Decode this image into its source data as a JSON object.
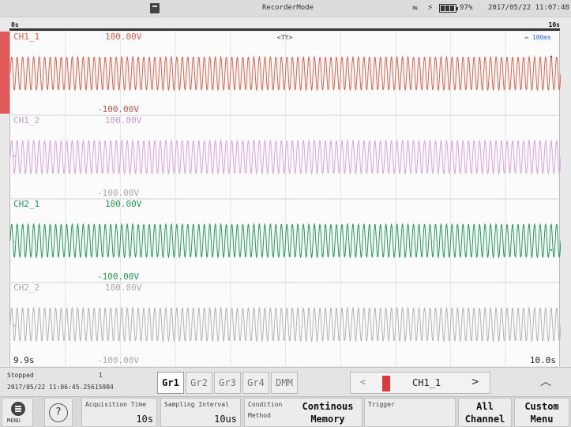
{
  "status_bar": {
    "mode": "RecorderMode",
    "battery_percent": "97%",
    "datetime": "2017/05/22 11:07:48",
    "icons": [
      "recorder-mode-icon",
      "usb-icon",
      "power-bolt-icon",
      "battery-icon"
    ]
  },
  "time_ruler": {
    "start": "0s",
    "end": "10s"
  },
  "waveform": {
    "trigger_label": "<TY>",
    "time_div": "↔ 100ms",
    "cursor_left": "9.9s",
    "cursor_right": "10.0s",
    "channels": [
      {
        "name": "CH1_1",
        "top": "100.00V",
        "bottom": "-100.00V",
        "color": "#e0604a"
      },
      {
        "name": "CH1_2",
        "top": "100.00V",
        "bottom": "-100.00V",
        "color": "#d7a5d9"
      },
      {
        "name": "CH2_1",
        "top": "100.00V",
        "bottom": "-100.00V",
        "color": "#1f9a55"
      },
      {
        "name": "CH2_2",
        "top": "100.00V",
        "bottom": "-100.00V",
        "color": "#b3b3b3"
      }
    ]
  },
  "status_row": {
    "state": "Stopped",
    "count": "1",
    "timestamp": "2017/05/22 11:06:45.25615984",
    "groups": [
      "Gr1",
      "Gr2",
      "Gr3",
      "Gr4",
      "DMM"
    ],
    "active_group": "Gr1",
    "channel_nav": {
      "prev": "<",
      "label": "CH1_1",
      "next": ">",
      "swatch_color": "#d93a3a"
    },
    "collapse": "^"
  },
  "bottom_bar": {
    "menu_label": "MENU",
    "help": "?",
    "acquisition_time": {
      "label": "Acquisition Time",
      "value": "10s"
    },
    "sampling_interval": {
      "label": "Sampling Interval",
      "value": "10us"
    },
    "condition": {
      "label": "Condition",
      "sublabel": "Method"
    },
    "method_value": {
      "line1": "Continous",
      "line2": "Memory"
    },
    "trigger": {
      "label": "Trigger"
    },
    "all_channel": {
      "line1": "All",
      "line2": "Channel"
    },
    "custom_menu": {
      "line1": "Custom",
      "line2": "Menu"
    }
  }
}
